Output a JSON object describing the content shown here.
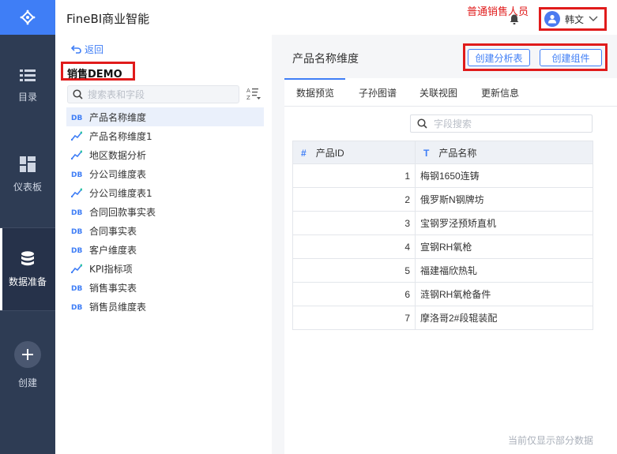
{
  "header": {
    "app_title": "FineBI商业智能",
    "annotation_role": "普通销售人员",
    "user_name": "韩文"
  },
  "rail": {
    "items": [
      {
        "label": "目录",
        "icon": "list-icon"
      },
      {
        "label": "仪表板",
        "icon": "dashboard-icon"
      },
      {
        "label": "数据准备",
        "icon": "database-icon",
        "active": true
      },
      {
        "label": "创建",
        "icon": "plus-icon"
      }
    ]
  },
  "left_panel": {
    "back_label": "返回",
    "package_name": "销售DEMO",
    "search_placeholder": "搜索表和字段",
    "tables": [
      {
        "name": "产品名称维度",
        "type": "db",
        "selected": true
      },
      {
        "name": "产品名称维度1",
        "type": "analysis"
      },
      {
        "name": "地区数据分析",
        "type": "analysis"
      },
      {
        "name": "分公司维度表",
        "type": "db"
      },
      {
        "name": "分公司维度表1",
        "type": "analysis"
      },
      {
        "name": "合同回款事实表",
        "type": "db"
      },
      {
        "name": "合同事实表",
        "type": "db"
      },
      {
        "name": "客户维度表",
        "type": "db"
      },
      {
        "name": "KPI指标项",
        "type": "analysis"
      },
      {
        "name": "销售事实表",
        "type": "db"
      },
      {
        "name": "销售员维度表",
        "type": "db"
      }
    ]
  },
  "main": {
    "table_title": "产品名称维度",
    "buttons": {
      "create_analysis": "创建分析表",
      "create_component": "创建组件"
    },
    "tabs": [
      "数据预览",
      "子孙图谱",
      "关联视图",
      "更新信息"
    ],
    "field_search_placeholder": "字段搜索",
    "columns": [
      {
        "label": "产品ID",
        "type_icon": "#"
      },
      {
        "label": "产品名称",
        "type_icon": "T"
      }
    ],
    "rows": [
      [
        "1",
        "梅钢1650连铸"
      ],
      [
        "2",
        "俄罗斯N钢牌坊"
      ],
      [
        "3",
        "宝钢罗泾预矫直机"
      ],
      [
        "4",
        "宣钢RH氧枪"
      ],
      [
        "5",
        "福建福欣热轧"
      ],
      [
        "6",
        "涟钢RH氧枪备件"
      ],
      [
        "7",
        "摩洛哥2#段辊装配"
      ]
    ],
    "footnote": "当前仅显示部分数据"
  },
  "colors": {
    "accent": "#3f7ef6",
    "rail_bg": "#2e3c54",
    "annotation": "#e01b1b"
  }
}
